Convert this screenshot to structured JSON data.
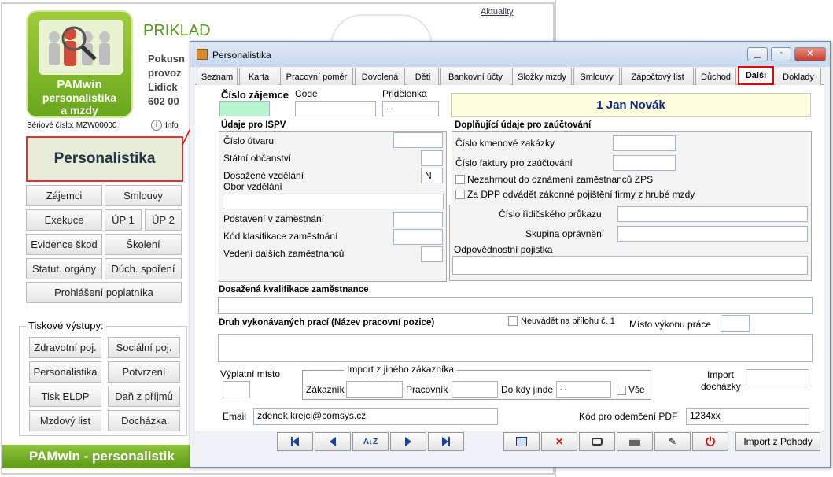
{
  "background": {
    "aktuality": "Aktuality",
    "title": "PRIKLAD",
    "company_lines": [
      "Pokusn",
      "provoz",
      "Lidick",
      "602 00"
    ],
    "logo_lines": [
      "PAMwin",
      "personalistika",
      "a mzdy"
    ],
    "serial": "Sériové číslo: MZW00000",
    "info": "Info",
    "main_button": "Personalistika",
    "buttons": [
      "Zájemci",
      "Smlouvy",
      "Exekuce",
      "ÚP 1",
      "ÚP 2",
      "Evidence škod",
      "Školení",
      "Statut. orgány",
      "Dúch. spoření",
      "Prohlášení poplatníka"
    ],
    "print_header": "Tiskové výstupy:",
    "print_buttons": [
      "Zdravotní poj.",
      "Sociální poj.",
      "Personalistika",
      "Potvrzení",
      "Tisk ELDP",
      "Daň z příjmů",
      "Mzdový list",
      "Docházka"
    ],
    "footer": "PAMwin - personalistik"
  },
  "dialog": {
    "title": "Personalistika",
    "tabs": [
      "Seznam",
      "Karta",
      "Pracovní poměr",
      "Dovolená",
      "Děti",
      "Bankovní účty",
      "Složky mzdy",
      "Smlouvy",
      "Zápočtový list",
      "Důchod",
      "Další",
      "Doklady"
    ],
    "active_tab": "Další",
    "fields": {
      "cislo_zajemce": "Číslo zájemce",
      "code": "Code",
      "pridelenka": "Přidělenka",
      "pridelenka_value": " .  .",
      "employee": "1 Jan Novák",
      "udaje_isp": "Údaje pro ISPV",
      "cislo_utvaru": "Číslo útvaru",
      "statni_obcanstvi": "Státní občanství",
      "dosazene_vzdelani": "Dosažené vzdělání",
      "dosazene_vzdelani_value": "N",
      "obor_vzdelani": "Obor vzdělání",
      "postaveni": "Postavení v zaměstnání",
      "kod_klasifikace": "Kód klasifikace zaměstnání",
      "vedeni": "Vedení dalších zaměstnanců",
      "doplnujici": "Doplňující údaje pro zaúčtování",
      "cislo_kmenove": "Číslo kmenové zakázky",
      "cislo_faktury": "Číslo faktury pro zaúčtování",
      "nezahrnout": "Nezahrnout do oznámení zaměstnanců ZPS",
      "za_dpp": "Za DPP odvádět zákonné pojištění firmy z hrubé mzdy",
      "ridicsky": "Číslo řidičského průkazu",
      "skupina": "Skupina oprávnění",
      "odpovednostni": "Odpovědnostní pojistka",
      "kvalifikace": "Dosažená kvalifikace zaměstnance",
      "druh_praci": "Druh vykonávaných prací (Název pracovní pozice)",
      "neuvadet": "Neuvádět na přílohu  č. 1",
      "misto_vykonu": "Místo výkonu práce",
      "vyplatni_misto": "Výplatní místo",
      "import_header": "Import z jiného zákazníka",
      "zakaznik": "Zákazník",
      "pracovnik": "Pracovník",
      "do_kdy": "Do kdy jinde",
      "do_kdy_value": " .  .",
      "vse": "Vše",
      "import_dochazky": "Import docházky",
      "email_label": "Email",
      "email_value": "zdenek.krejci@comsys.cz",
      "kod_pdf": "Kód pro odemčení PDF",
      "kod_pdf_value": "1234xx"
    },
    "import_pohody": "Import z Pohody"
  }
}
